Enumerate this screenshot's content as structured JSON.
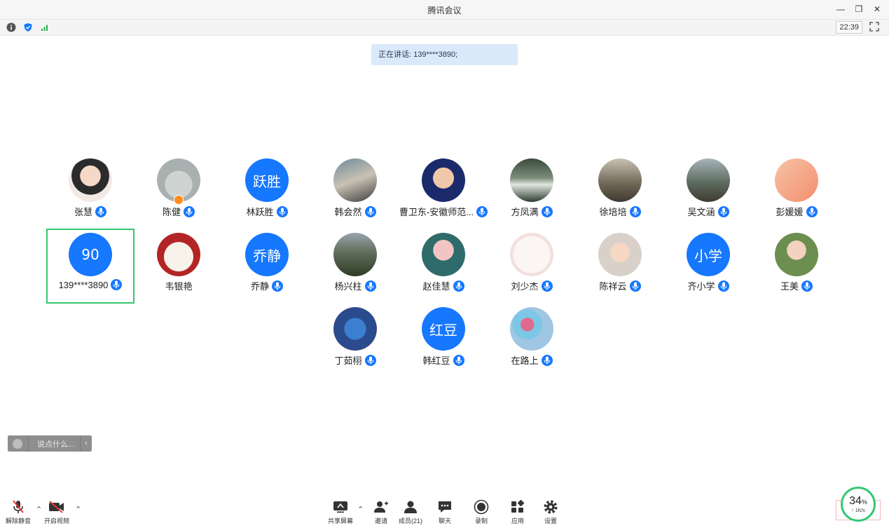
{
  "window": {
    "title": "腾讯会议"
  },
  "topbar": {
    "clock": "22:39"
  },
  "banner": {
    "speaking": "正在讲话: 139****3890;"
  },
  "participants": [
    {
      "name": "张慧",
      "avatar": "photo",
      "avatar_text": ""
    },
    {
      "name": "陈健",
      "avatar": "photo",
      "avatar_text": ""
    },
    {
      "name": "林跃胜",
      "avatar": "text",
      "avatar_text": "跃胜"
    },
    {
      "name": "韩会然",
      "avatar": "photo",
      "avatar_text": ""
    },
    {
      "name": "曹卫东-安徽师范...",
      "avatar": "photo",
      "avatar_text": ""
    },
    {
      "name": "方凤满",
      "avatar": "photo",
      "avatar_text": ""
    },
    {
      "name": "徐培培",
      "avatar": "photo",
      "avatar_text": ""
    },
    {
      "name": "吴文涵",
      "avatar": "photo",
      "avatar_text": ""
    },
    {
      "name": "彭媛媛",
      "avatar": "photo",
      "avatar_text": ""
    },
    {
      "name": "139****3890",
      "avatar": "text",
      "avatar_text": "90"
    },
    {
      "name": "韦银艳",
      "avatar": "photo",
      "avatar_text": ""
    },
    {
      "name": "乔静",
      "avatar": "text",
      "avatar_text": "乔静"
    },
    {
      "name": "杨兴柱",
      "avatar": "photo",
      "avatar_text": ""
    },
    {
      "name": "赵佳慧",
      "avatar": "photo",
      "avatar_text": ""
    },
    {
      "name": "刘少杰",
      "avatar": "photo",
      "avatar_text": ""
    },
    {
      "name": "陈祥云",
      "avatar": "photo",
      "avatar_text": ""
    },
    {
      "name": "齐小学",
      "avatar": "text",
      "avatar_text": "小学"
    },
    {
      "name": "王美",
      "avatar": "photo",
      "avatar_text": ""
    },
    {
      "name": "丁茹栩",
      "avatar": "photo",
      "avatar_text": ""
    },
    {
      "name": "韩红豆",
      "avatar": "text",
      "avatar_text": "红豆"
    },
    {
      "name": "在路上",
      "avatar": "photo",
      "avatar_text": ""
    }
  ],
  "chat": {
    "placeholder": "说点什么..."
  },
  "controls": {
    "unmute": "解除静音",
    "start_video": "开启视频",
    "share_screen": "共享屏幕",
    "invite": "邀请",
    "members": "成员(21)",
    "chat": "聊天",
    "record": "录制",
    "apps": "应用",
    "settings": "设置"
  },
  "network": {
    "percent": "34",
    "percent_unit": "%",
    "speed": "↑ 1K/s"
  },
  "colors": {
    "accent": "#1677ff",
    "active_border": "#37c66d",
    "banner_bg": "#dbe9fb"
  }
}
